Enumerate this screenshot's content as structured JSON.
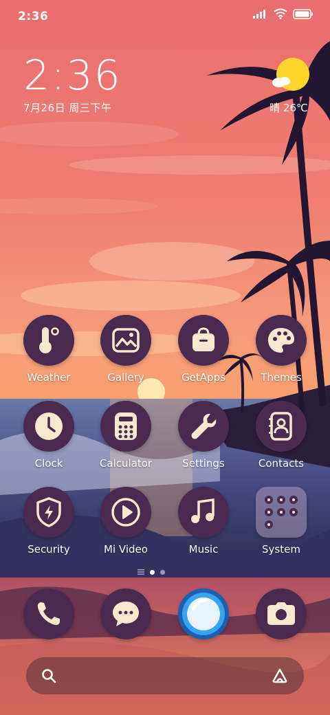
{
  "status_bar": {
    "time": "2:36"
  },
  "lock_clock": {
    "time": "2:36",
    "date": "7月26日 周三下午"
  },
  "weather": {
    "text": "晴 26℃"
  },
  "apps": [
    {
      "label": "Weather",
      "icon": "thermometer-icon"
    },
    {
      "label": "Gallery",
      "icon": "gallery-icon"
    },
    {
      "label": "GetApps",
      "icon": "shopping-bag-icon"
    },
    {
      "label": "Themes",
      "icon": "palette-icon"
    },
    {
      "label": "Clock",
      "icon": "clock-icon"
    },
    {
      "label": "Calculator",
      "icon": "calculator-icon"
    },
    {
      "label": "Settings",
      "icon": "wrench-icon"
    },
    {
      "label": "Contacts",
      "icon": "contacts-icon"
    },
    {
      "label": "Security",
      "icon": "shield-icon"
    },
    {
      "label": "Mi Video",
      "icon": "play-icon"
    },
    {
      "label": "Music",
      "icon": "music-note-icon"
    },
    {
      "label": "System",
      "icon": "folder-icon"
    }
  ],
  "dock": [
    {
      "icon": "phone-icon"
    },
    {
      "icon": "messages-icon"
    },
    {
      "icon": "browser-icon"
    },
    {
      "icon": "camera-icon"
    }
  ],
  "colors": {
    "icon_bg": "#4a2b4f",
    "icon_fg": "#f7e8d0",
    "browser": "#3aa3f0"
  }
}
